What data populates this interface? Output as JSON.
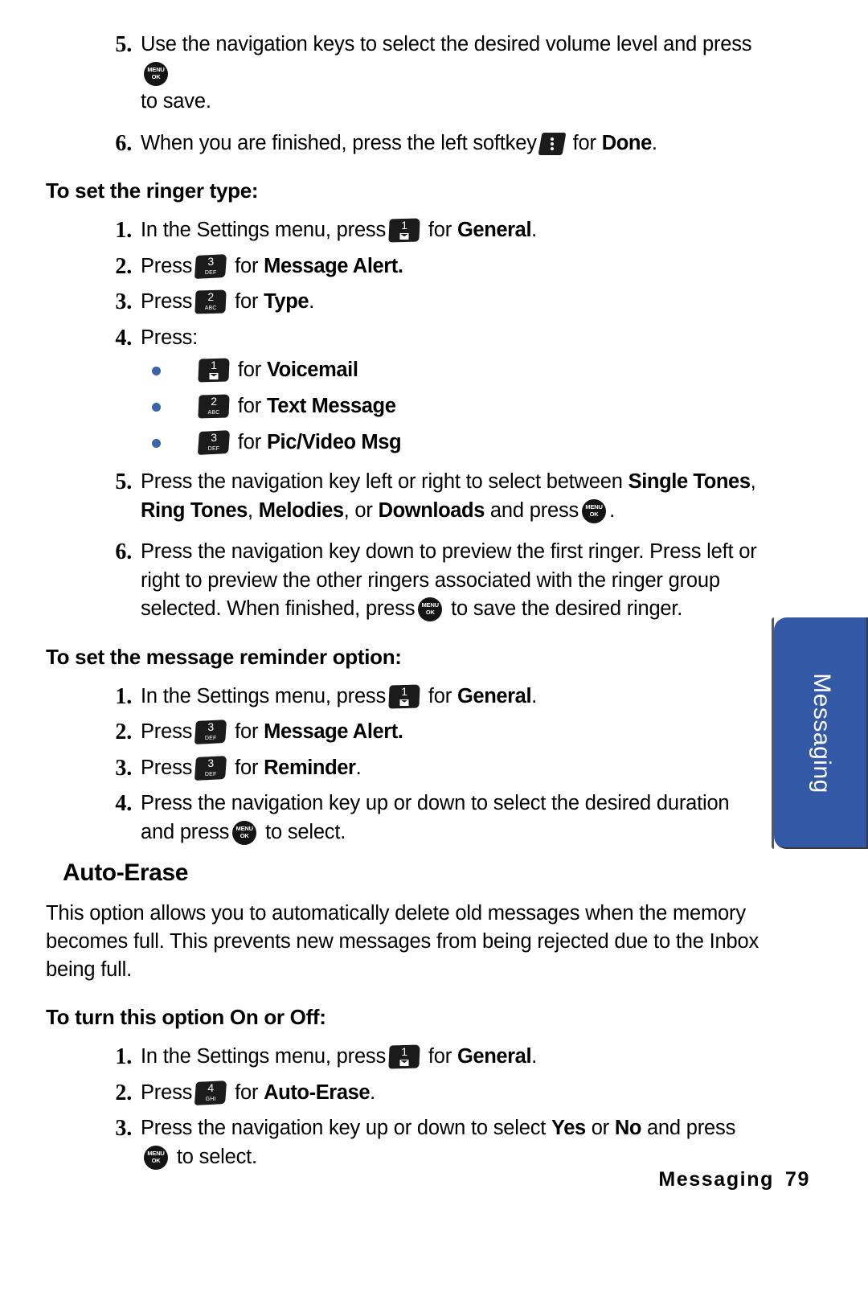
{
  "page": {
    "footer_section": "Messaging",
    "footer_page_number": "79",
    "side_tab_label": "Messaging"
  },
  "icons": {
    "menu_ok_line1": "MENU",
    "menu_ok_line2": "OK",
    "key1_digit": "1",
    "key2_digit": "2",
    "key2_sub": "ABC",
    "key3_digit": "3",
    "key3_sub": "DEF",
    "key4_digit": "4",
    "key4_sub": "GHI"
  },
  "top_steps": {
    "step5_num": "5.",
    "step5_text_a": "Use the navigation keys to select the desired volume level and press",
    "step5_text_b": "to save.",
    "step6_num": "6.",
    "step6_text_a": "When you are finished, press the left softkey",
    "step6_text_b": "for",
    "step6_bold": "Done",
    "step6_text_c": "."
  },
  "ringer_type": {
    "heading": "To set the ringer type:",
    "step1_num": "1.",
    "step1_text_a": "In the Settings menu, press",
    "step1_text_b": "for",
    "step1_bold": "General",
    "step1_text_c": ".",
    "step2_num": "2.",
    "step2_text_a": "Press",
    "step2_text_b": "for",
    "step2_bold": "Message Alert.",
    "step3_num": "3.",
    "step3_text_a": "Press",
    "step3_text_b": "for",
    "step3_bold": "Type",
    "step3_text_c": ".",
    "step4_num": "4.",
    "step4_text": "Press:",
    "bullet1_for": "for",
    "bullet1_bold": "Voicemail",
    "bullet2_for": "for",
    "bullet2_bold": "Text Message",
    "bullet3_for": "for",
    "bullet3_bold": "Pic/Video Msg",
    "step5_num": "5.",
    "step5_a": "Press the navigation key left or right to select between",
    "step5_b1": "Single Tones",
    "step5_c": ",",
    "step5_b2": "Ring Tones",
    "step5_d": ",",
    "step5_b3": "Melodies",
    "step5_e": ", or",
    "step5_b4": "Downloads",
    "step5_f": "and press",
    "step5_g": ".",
    "step6_num": "6.",
    "step6_a": "Press the navigation key down to preview the first ringer. Press left or right to preview the other ringers associated with the ringer group selected. When finished, press",
    "step6_b": "to save the desired ringer."
  },
  "message_reminder": {
    "heading": "To set the message reminder option:",
    "step1_num": "1.",
    "step1_text_a": "In the Settings menu, press",
    "step1_text_b": "for",
    "step1_bold": "General",
    "step1_text_c": ".",
    "step2_num": "2.",
    "step2_text_a": "Press",
    "step2_text_b": "for",
    "step2_bold": "Message Alert.",
    "step3_num": "3.",
    "step3_text_a": "Press",
    "step3_text_b": "for",
    "step3_bold": "Reminder",
    "step3_text_c": ".",
    "step4_num": "4.",
    "step4_a": "Press the navigation key up or down to select the desired duration and press",
    "step4_b": "to select."
  },
  "auto_erase": {
    "heading": "Auto-Erase",
    "body": "This option allows you to automatically delete old messages when the memory becomes full. This prevents new messages from being rejected due to the Inbox being full."
  },
  "on_off": {
    "heading": "To turn this option On or Off:",
    "step1_num": "1.",
    "step1_text_a": "In the Settings menu, press",
    "step1_text_b": "for",
    "step1_bold": "General",
    "step1_text_c": ".",
    "step2_num": "2.",
    "step2_text_a": "Press",
    "step2_text_b": "for",
    "step2_bold": "Auto-Erase",
    "step2_text_c": ".",
    "step3_num": "3.",
    "step3_a": "Press the navigation key up or down to select",
    "step3_b1": "Yes",
    "step3_or": "or",
    "step3_b2": "No",
    "step3_c": "and press",
    "step3_d": "to select."
  }
}
